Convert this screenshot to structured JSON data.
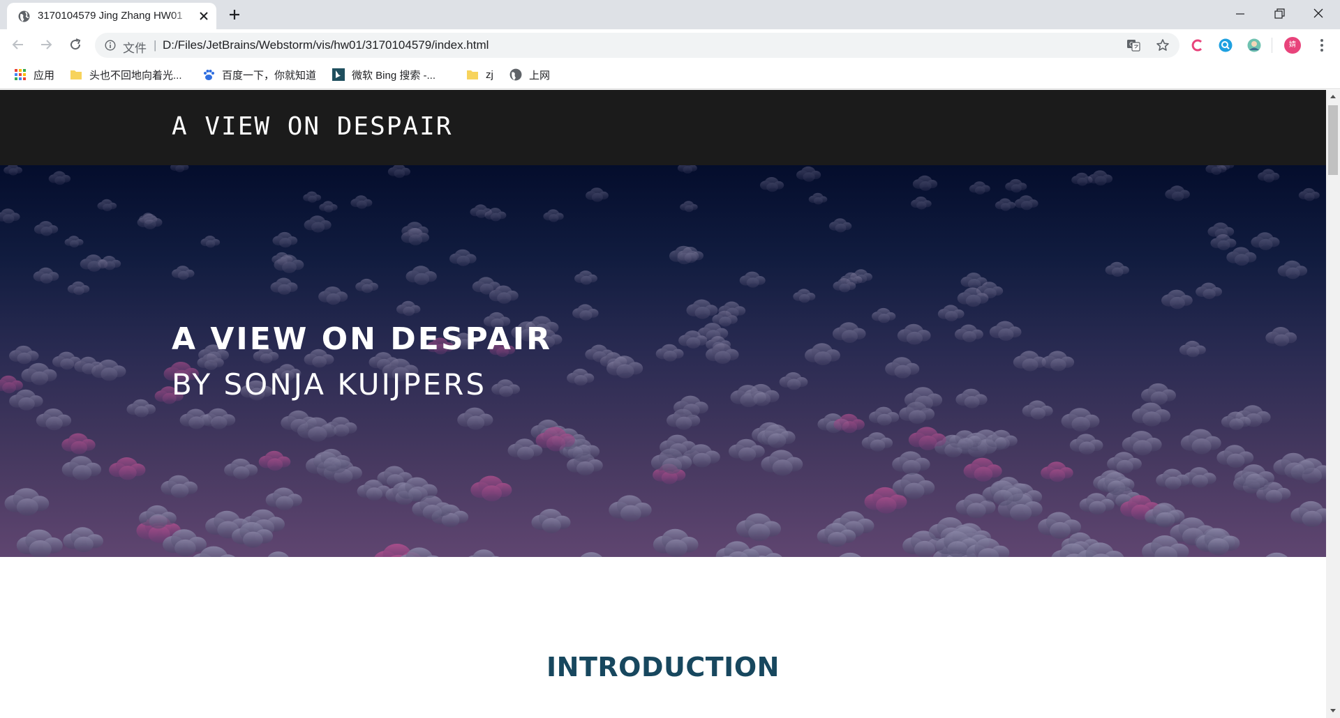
{
  "tab": {
    "title": "3170104579 Jing Zhang HW01",
    "icon": "globe-icon"
  },
  "toolbar": {
    "omnibox_label": "文件",
    "omnibox_separator": "|",
    "url": "D:/Files/JetBrains/Webstorm/vis/hw01/3170104579/index.html",
    "profile_initial": "婧"
  },
  "bookmarks": [
    {
      "label": "应用",
      "icon": "apps-grid-icon"
    },
    {
      "label": "头也不回地向着光...",
      "icon": "folder-icon"
    },
    {
      "label": "百度一下，你就知道",
      "icon": "baidu-paw-icon"
    },
    {
      "label": "微软 Bing 搜索 -...",
      "icon": "bing-icon"
    },
    {
      "label": "zj",
      "icon": "folder-icon"
    },
    {
      "label": "上网",
      "icon": "globe-icon"
    }
  ],
  "page": {
    "site_logo": "A VIEW ON DESPAIR",
    "hero_title": "A VIEW ON DESPAIR",
    "hero_subtitle": "BY SONJA KUIJPERS",
    "intro_heading": "INTRODUCTION"
  },
  "colors": {
    "header_bg": "#1b1b1b",
    "hero_top": "#040d2c",
    "hero_bottom": "#5f4570",
    "heading": "#17475e",
    "profile": "#e8437b"
  }
}
